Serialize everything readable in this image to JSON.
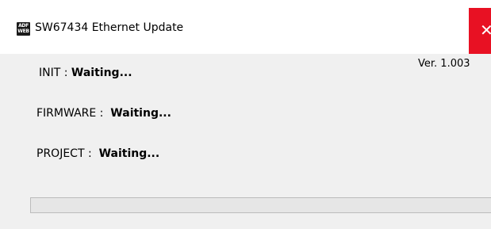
{
  "window": {
    "title": "SW67434 Ethernet Update",
    "app_icon_text_top": "ADF",
    "app_icon_text_bottom": "WEB",
    "close_glyph": "✕"
  },
  "version": "Ver. 1.003",
  "status": {
    "init": {
      "label": "INIT : ",
      "value": "Waiting..."
    },
    "firmware": {
      "label": "FIRMWARE :  ",
      "value": "Waiting..."
    },
    "project": {
      "label": "PROJECT :  ",
      "value": "Waiting..."
    }
  },
  "progress": {
    "value": 0
  },
  "colors": {
    "close_button": "#e81123",
    "window_bg": "#f0f0f0",
    "progress_track": "#e6e6e6"
  },
  "icons": {
    "app": "adfweb-logo-icon",
    "close": "close-icon"
  }
}
